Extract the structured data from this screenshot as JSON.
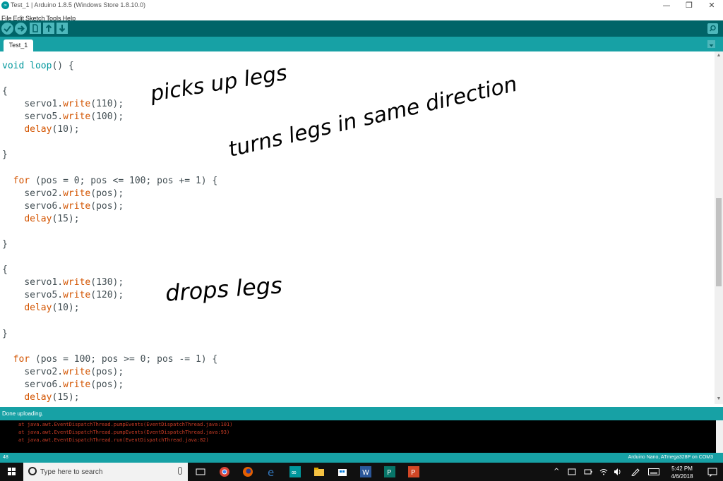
{
  "window": {
    "title": "Test_1 | Arduino 1.8.5 (Windows Store 1.8.10.0)",
    "app_icon_label": "∞",
    "min_label": "—",
    "restore_label": "❐",
    "close_label": "✕"
  },
  "menu": {
    "items": [
      "File",
      "Edit",
      "Sketch",
      "Tools",
      "Help"
    ]
  },
  "toolbar": {
    "verify_icon": "check-icon",
    "upload_icon": "arrow-right-icon",
    "new_icon": "new-file-icon",
    "open_icon": "arrow-up-icon",
    "save_icon": "arrow-down-icon",
    "serial_icon": "magnifier-icon"
  },
  "tabs": {
    "active": "Test_1"
  },
  "code": {
    "l1_kw1": "void",
    "l1_kw2": "loop",
    "l1_rest": "() {",
    "brace_open": "{",
    "brace_close": "}",
    "s1_obj": "servo1.",
    "s5_obj": "servo5.",
    "s2_obj": "servo2.",
    "s6_obj": "servo6.",
    "write_fn": "write",
    "delay_fn": "delay",
    "arg_110": "(110);",
    "arg_100": "(100);",
    "arg_10": "(10);",
    "arg_15": "(15);",
    "arg_130": "(130);",
    "arg_120": "(120);",
    "arg_pos": "(pos);",
    "for_kw": "for",
    "for1_rest": " (pos = 0; pos <= 100; pos += 1) {",
    "for2_rest": " (pos = 100; pos >= 0; pos -= 1) {"
  },
  "annotations": {
    "note1": "picks up legs",
    "note2": "turns legs in same direction",
    "note3": "drops legs"
  },
  "status": {
    "message": "Done uploading."
  },
  "console": {
    "lines": [
      "at java.awt.EventDispatchThread.pumpEvents(EventDispatchThread.java:101)",
      "at java.awt.EventDispatchThread.pumpEvents(EventDispatchThread.java:93)",
      "at java.awt.EventDispatchThread.run(EventDispatchThread.java:82)"
    ]
  },
  "bottom": {
    "line_number": "48",
    "board": "Arduino Nano, ATmega328P on COM3"
  },
  "taskbar": {
    "search_placeholder": "Type here to search",
    "time": "5:42 PM",
    "date": "4/6/2018",
    "apps": [
      "task-view-icon",
      "chrome-icon",
      "firefox-icon",
      "edge-icon",
      "arduino-icon",
      "file-explorer-icon",
      "store-icon",
      "word-icon",
      "publisher-icon",
      "powerpoint-icon"
    ]
  },
  "colors": {
    "teal_dark": "#006468",
    "teal": "#17a1a5",
    "keyword": "#00979c",
    "function": "#d35400",
    "console_text": "#cc3d26"
  }
}
